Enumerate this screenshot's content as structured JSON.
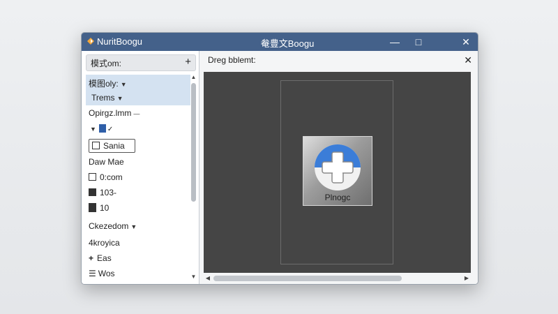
{
  "window": {
    "app_name": "NuritBoogu",
    "title": "奙豊文Boogu",
    "controls": {
      "minimize": "—",
      "maximize": "□",
      "close": "✕"
    }
  },
  "sidebar": {
    "header_label": "模式om:",
    "add_symbol": "+",
    "items": [
      {
        "label": "模图oly:",
        "icon": null
      },
      {
        "label": "Trems",
        "icon": null
      },
      {
        "label": "Opirgz.lmm",
        "icon": null
      },
      {
        "label": "",
        "icon": "doc-icon"
      },
      {
        "label": "Sania",
        "icon": "square-icon"
      },
      {
        "label": "Daw Mae",
        "icon": null
      },
      {
        "label": "0:com",
        "icon": "square-icon"
      },
      {
        "label": "103-",
        "icon": "filled-square-icon"
      },
      {
        "label": "10",
        "icon": "tab-icon"
      },
      {
        "label": "Ckezedom",
        "icon": null
      },
      {
        "label": "4kroyica",
        "icon": null
      },
      {
        "label": "Eas",
        "icon": "plus-icon"
      },
      {
        "label": "Wos",
        "icon": "list-icon"
      }
    ]
  },
  "main": {
    "label": "Dreg bblemt:",
    "close_symbol": "✕",
    "item_label": "Plnogc"
  },
  "colors": {
    "titlebar": "#44618a",
    "selection": "#d4e2f1",
    "canvas": "#454545",
    "accent_blue": "#3b7dd8"
  }
}
